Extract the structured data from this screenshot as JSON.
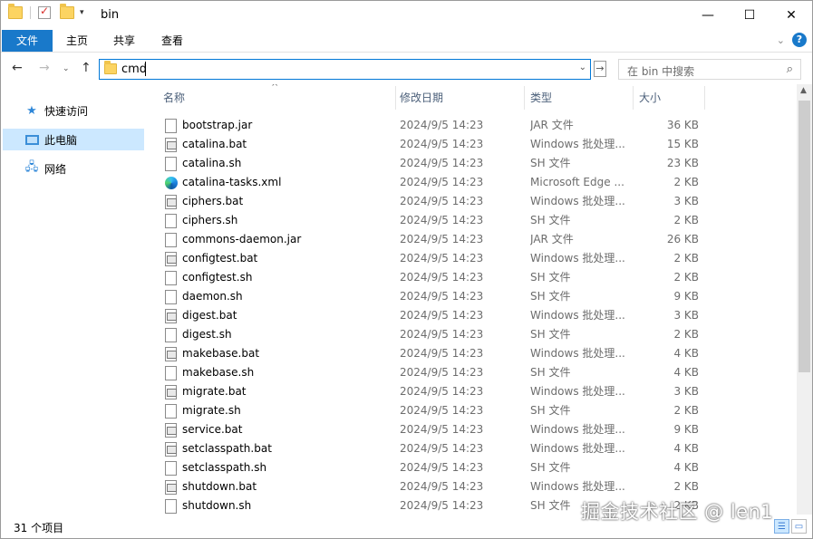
{
  "window": {
    "title": "bin",
    "minimize_glyph": "—",
    "maximize_glyph": "☐",
    "close_glyph": "✕"
  },
  "ribbon": {
    "tabs": [
      "文件",
      "主页",
      "共享",
      "查看"
    ],
    "expand_glyph": "⌄",
    "help_glyph": "?"
  },
  "navbar": {
    "back_glyph": "←",
    "forward_glyph": "→",
    "recent_glyph": "⌄",
    "up_glyph": "↑",
    "address_value": "cmd",
    "go_glyph": "→",
    "search_placeholder": "在 bin 中搜索",
    "search_glyph": "⌕"
  },
  "sidebar": {
    "items": [
      {
        "label": "快速访问",
        "icon": "star-icon"
      },
      {
        "label": "此电脑",
        "icon": "computer-icon"
      },
      {
        "label": "网络",
        "icon": "network-icon"
      }
    ]
  },
  "columns": {
    "name": "名称",
    "date": "修改日期",
    "type": "类型",
    "size": "大小"
  },
  "files": [
    {
      "name": "bootstrap.jar",
      "date": "2024/9/5 14:23",
      "type": "JAR 文件",
      "size": "36 KB",
      "icon": "file"
    },
    {
      "name": "catalina.bat",
      "date": "2024/9/5 14:23",
      "type": "Windows 批处理...",
      "size": "15 KB",
      "icon": "bat"
    },
    {
      "name": "catalina.sh",
      "date": "2024/9/5 14:23",
      "type": "SH 文件",
      "size": "23 KB",
      "icon": "file"
    },
    {
      "name": "catalina-tasks.xml",
      "date": "2024/9/5 14:23",
      "type": "Microsoft Edge ...",
      "size": "2 KB",
      "icon": "edge"
    },
    {
      "name": "ciphers.bat",
      "date": "2024/9/5 14:23",
      "type": "Windows 批处理...",
      "size": "3 KB",
      "icon": "bat"
    },
    {
      "name": "ciphers.sh",
      "date": "2024/9/5 14:23",
      "type": "SH 文件",
      "size": "2 KB",
      "icon": "file"
    },
    {
      "name": "commons-daemon.jar",
      "date": "2024/9/5 14:23",
      "type": "JAR 文件",
      "size": "26 KB",
      "icon": "file"
    },
    {
      "name": "configtest.bat",
      "date": "2024/9/5 14:23",
      "type": "Windows 批处理...",
      "size": "2 KB",
      "icon": "bat"
    },
    {
      "name": "configtest.sh",
      "date": "2024/9/5 14:23",
      "type": "SH 文件",
      "size": "2 KB",
      "icon": "file"
    },
    {
      "name": "daemon.sh",
      "date": "2024/9/5 14:23",
      "type": "SH 文件",
      "size": "9 KB",
      "icon": "file"
    },
    {
      "name": "digest.bat",
      "date": "2024/9/5 14:23",
      "type": "Windows 批处理...",
      "size": "3 KB",
      "icon": "bat"
    },
    {
      "name": "digest.sh",
      "date": "2024/9/5 14:23",
      "type": "SH 文件",
      "size": "2 KB",
      "icon": "file"
    },
    {
      "name": "makebase.bat",
      "date": "2024/9/5 14:23",
      "type": "Windows 批处理...",
      "size": "4 KB",
      "icon": "bat"
    },
    {
      "name": "makebase.sh",
      "date": "2024/9/5 14:23",
      "type": "SH 文件",
      "size": "4 KB",
      "icon": "file"
    },
    {
      "name": "migrate.bat",
      "date": "2024/9/5 14:23",
      "type": "Windows 批处理...",
      "size": "3 KB",
      "icon": "bat"
    },
    {
      "name": "migrate.sh",
      "date": "2024/9/5 14:23",
      "type": "SH 文件",
      "size": "2 KB",
      "icon": "file"
    },
    {
      "name": "service.bat",
      "date": "2024/9/5 14:23",
      "type": "Windows 批处理...",
      "size": "9 KB",
      "icon": "bat"
    },
    {
      "name": "setclasspath.bat",
      "date": "2024/9/5 14:23",
      "type": "Windows 批处理...",
      "size": "4 KB",
      "icon": "bat"
    },
    {
      "name": "setclasspath.sh",
      "date": "2024/9/5 14:23",
      "type": "SH 文件",
      "size": "4 KB",
      "icon": "file"
    },
    {
      "name": "shutdown.bat",
      "date": "2024/9/5 14:23",
      "type": "Windows 批处理...",
      "size": "2 KB",
      "icon": "bat"
    },
    {
      "name": "shutdown.sh",
      "date": "2024/9/5 14:23",
      "type": "SH 文件",
      "size": "2 KB",
      "icon": "file"
    }
  ],
  "status": {
    "item_count": "31 个项目"
  },
  "watermark": "掘金技术社区 @ len1"
}
